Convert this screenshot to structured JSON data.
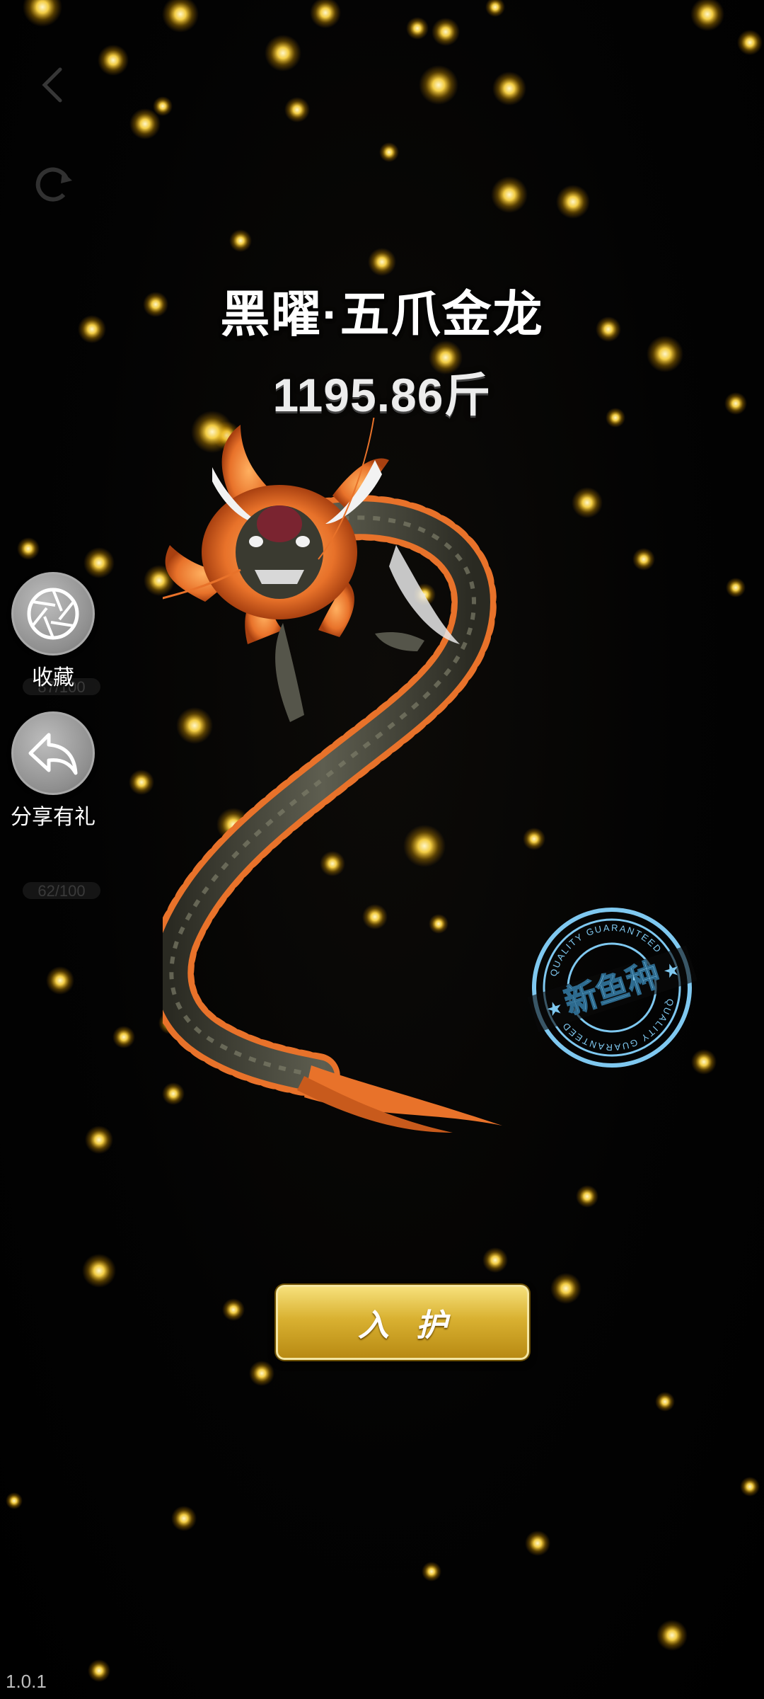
{
  "fish": {
    "name": "黑曜·五爪金龙",
    "weight": "1195.86斤"
  },
  "side_actions": {
    "collect_label": "收藏",
    "share_label": "分享有礼"
  },
  "faded_counters": [
    "87/100",
    "62/100"
  ],
  "stamp": {
    "main_text": "新鱼种",
    "ring_text": "QUALITY GUARANTEED"
  },
  "enter_button": {
    "label": "入护"
  },
  "footer": {
    "version": "1.0.1"
  },
  "icons": {
    "back": "back-arrow-icon",
    "refresh": "refresh-icon",
    "collect": "camera-shutter-icon",
    "share": "share-arrow-icon"
  },
  "colors": {
    "particle": "#ffd84a",
    "button_gold": "#d9b131",
    "stamp_blue": "#7fc8f0",
    "dragon_fin": "#e8722a"
  }
}
